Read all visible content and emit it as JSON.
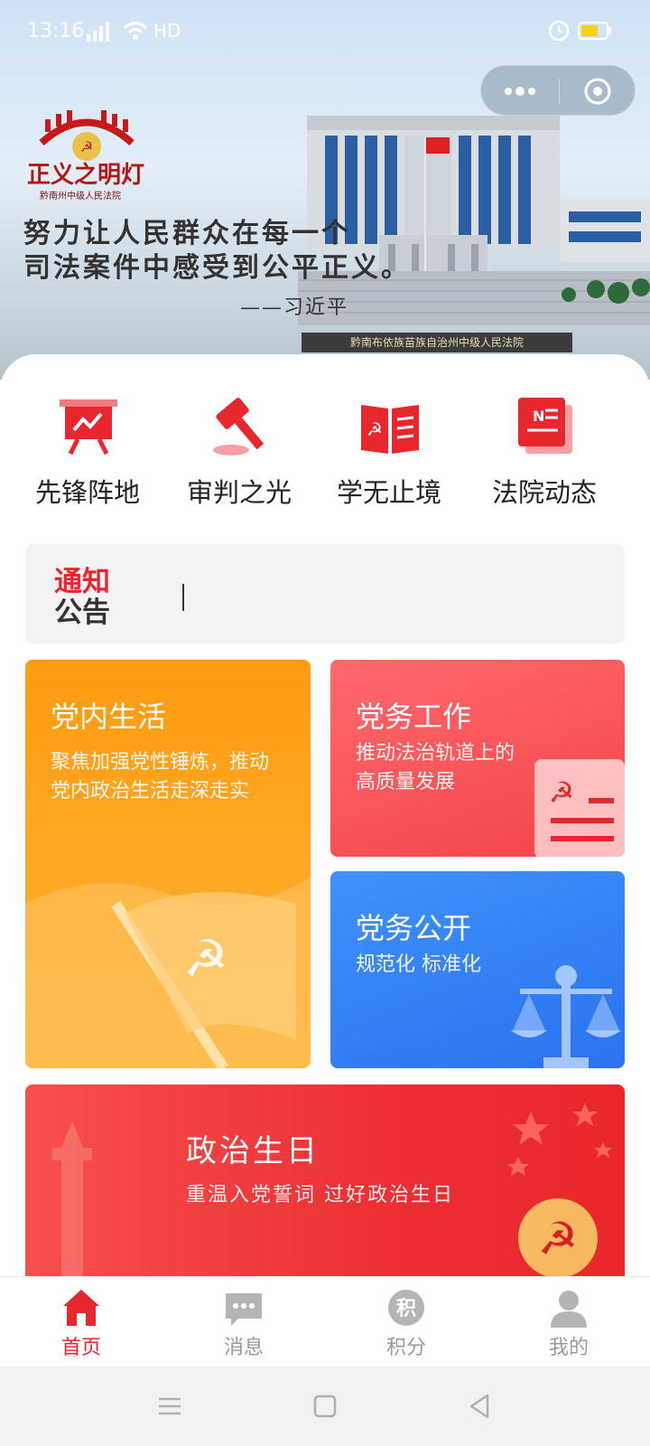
{
  "status_bar": {
    "time": "13:16",
    "network": "HD",
    "battery_color": "#f5d40f"
  },
  "banner": {
    "logo_text": "正义之明灯",
    "logo_subtitle": "黔南州中级人民法院",
    "quote_line1": "努力让人民群众在每一个",
    "quote_line2": "司法案件中感受到公平正义。",
    "quote_author": "——习近平",
    "court_sign": "黔南布依族苗族自治州中级人民法院"
  },
  "capsule": {
    "more_icon": "more-dots-icon",
    "close_icon": "target-close-icon"
  },
  "quick_nav": [
    {
      "label": "先锋阵地",
      "icon": "presentation-chart-icon"
    },
    {
      "label": "审判之光",
      "icon": "gavel-icon"
    },
    {
      "label": "学无止境",
      "icon": "party-book-icon"
    },
    {
      "label": "法院动态",
      "icon": "news-icon"
    }
  ],
  "notice": {
    "title_line1": "通知",
    "title_line2": "公告"
  },
  "cards": {
    "party_life": {
      "title": "党内生活",
      "subtitle_line1": "聚焦加强党性锤炼，推动",
      "subtitle_line2": "党内政治生活走深走实"
    },
    "party_work": {
      "title": "党务工作",
      "subtitle_line1": "推动法治轨道上的",
      "subtitle_line2": "高质量发展"
    },
    "party_open": {
      "title": "党务公开",
      "subtitle_line1": "规范化 标准化"
    },
    "political_birthday": {
      "title": "政治生日",
      "subtitle": "重温入党誓词 过好政治生日"
    }
  },
  "tabbar": [
    {
      "label": "首页",
      "icon": "home-icon",
      "active": true
    },
    {
      "label": "消息",
      "icon": "message-icon",
      "active": false
    },
    {
      "label": "积分",
      "icon": "points-icon",
      "active": false,
      "icon_text": "积"
    },
    {
      "label": "我的",
      "icon": "profile-icon",
      "active": false
    }
  ],
  "colors": {
    "accent": "#e8262d",
    "orange": "#ff9b0f",
    "blue": "#2b72ef",
    "inactive": "#999999"
  }
}
